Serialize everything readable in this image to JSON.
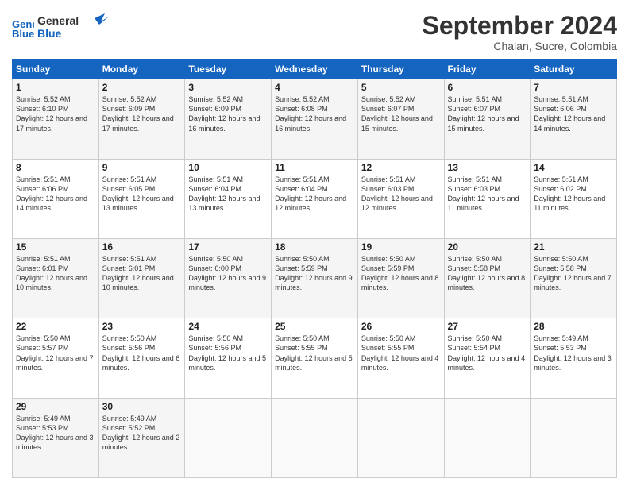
{
  "logo": {
    "line1": "General",
    "line2": "Blue"
  },
  "header": {
    "month_title": "September 2024",
    "subtitle": "Chalan, Sucre, Colombia"
  },
  "weekdays": [
    "Sunday",
    "Monday",
    "Tuesday",
    "Wednesday",
    "Thursday",
    "Friday",
    "Saturday"
  ],
  "weeks": [
    [
      {
        "day": "1",
        "sunrise": "Sunrise: 5:52 AM",
        "sunset": "Sunset: 6:10 PM",
        "daylight": "Daylight: 12 hours and 17 minutes."
      },
      {
        "day": "2",
        "sunrise": "Sunrise: 5:52 AM",
        "sunset": "Sunset: 6:09 PM",
        "daylight": "Daylight: 12 hours and 17 minutes."
      },
      {
        "day": "3",
        "sunrise": "Sunrise: 5:52 AM",
        "sunset": "Sunset: 6:09 PM",
        "daylight": "Daylight: 12 hours and 16 minutes."
      },
      {
        "day": "4",
        "sunrise": "Sunrise: 5:52 AM",
        "sunset": "Sunset: 6:08 PM",
        "daylight": "Daylight: 12 hours and 16 minutes."
      },
      {
        "day": "5",
        "sunrise": "Sunrise: 5:52 AM",
        "sunset": "Sunset: 6:07 PM",
        "daylight": "Daylight: 12 hours and 15 minutes."
      },
      {
        "day": "6",
        "sunrise": "Sunrise: 5:51 AM",
        "sunset": "Sunset: 6:07 PM",
        "daylight": "Daylight: 12 hours and 15 minutes."
      },
      {
        "day": "7",
        "sunrise": "Sunrise: 5:51 AM",
        "sunset": "Sunset: 6:06 PM",
        "daylight": "Daylight: 12 hours and 14 minutes."
      }
    ],
    [
      {
        "day": "8",
        "sunrise": "Sunrise: 5:51 AM",
        "sunset": "Sunset: 6:06 PM",
        "daylight": "Daylight: 12 hours and 14 minutes."
      },
      {
        "day": "9",
        "sunrise": "Sunrise: 5:51 AM",
        "sunset": "Sunset: 6:05 PM",
        "daylight": "Daylight: 12 hours and 13 minutes."
      },
      {
        "day": "10",
        "sunrise": "Sunrise: 5:51 AM",
        "sunset": "Sunset: 6:04 PM",
        "daylight": "Daylight: 12 hours and 13 minutes."
      },
      {
        "day": "11",
        "sunrise": "Sunrise: 5:51 AM",
        "sunset": "Sunset: 6:04 PM",
        "daylight": "Daylight: 12 hours and 12 minutes."
      },
      {
        "day": "12",
        "sunrise": "Sunrise: 5:51 AM",
        "sunset": "Sunset: 6:03 PM",
        "daylight": "Daylight: 12 hours and 12 minutes."
      },
      {
        "day": "13",
        "sunrise": "Sunrise: 5:51 AM",
        "sunset": "Sunset: 6:03 PM",
        "daylight": "Daylight: 12 hours and 11 minutes."
      },
      {
        "day": "14",
        "sunrise": "Sunrise: 5:51 AM",
        "sunset": "Sunset: 6:02 PM",
        "daylight": "Daylight: 12 hours and 11 minutes."
      }
    ],
    [
      {
        "day": "15",
        "sunrise": "Sunrise: 5:51 AM",
        "sunset": "Sunset: 6:01 PM",
        "daylight": "Daylight: 12 hours and 10 minutes."
      },
      {
        "day": "16",
        "sunrise": "Sunrise: 5:51 AM",
        "sunset": "Sunset: 6:01 PM",
        "daylight": "Daylight: 12 hours and 10 minutes."
      },
      {
        "day": "17",
        "sunrise": "Sunrise: 5:50 AM",
        "sunset": "Sunset: 6:00 PM",
        "daylight": "Daylight: 12 hours and 9 minutes."
      },
      {
        "day": "18",
        "sunrise": "Sunrise: 5:50 AM",
        "sunset": "Sunset: 5:59 PM",
        "daylight": "Daylight: 12 hours and 9 minutes."
      },
      {
        "day": "19",
        "sunrise": "Sunrise: 5:50 AM",
        "sunset": "Sunset: 5:59 PM",
        "daylight": "Daylight: 12 hours and 8 minutes."
      },
      {
        "day": "20",
        "sunrise": "Sunrise: 5:50 AM",
        "sunset": "Sunset: 5:58 PM",
        "daylight": "Daylight: 12 hours and 8 minutes."
      },
      {
        "day": "21",
        "sunrise": "Sunrise: 5:50 AM",
        "sunset": "Sunset: 5:58 PM",
        "daylight": "Daylight: 12 hours and 7 minutes."
      }
    ],
    [
      {
        "day": "22",
        "sunrise": "Sunrise: 5:50 AM",
        "sunset": "Sunset: 5:57 PM",
        "daylight": "Daylight: 12 hours and 7 minutes."
      },
      {
        "day": "23",
        "sunrise": "Sunrise: 5:50 AM",
        "sunset": "Sunset: 5:56 PM",
        "daylight": "Daylight: 12 hours and 6 minutes."
      },
      {
        "day": "24",
        "sunrise": "Sunrise: 5:50 AM",
        "sunset": "Sunset: 5:56 PM",
        "daylight": "Daylight: 12 hours and 5 minutes."
      },
      {
        "day": "25",
        "sunrise": "Sunrise: 5:50 AM",
        "sunset": "Sunset: 5:55 PM",
        "daylight": "Daylight: 12 hours and 5 minutes."
      },
      {
        "day": "26",
        "sunrise": "Sunrise: 5:50 AM",
        "sunset": "Sunset: 5:55 PM",
        "daylight": "Daylight: 12 hours and 4 minutes."
      },
      {
        "day": "27",
        "sunrise": "Sunrise: 5:50 AM",
        "sunset": "Sunset: 5:54 PM",
        "daylight": "Daylight: 12 hours and 4 minutes."
      },
      {
        "day": "28",
        "sunrise": "Sunrise: 5:49 AM",
        "sunset": "Sunset: 5:53 PM",
        "daylight": "Daylight: 12 hours and 3 minutes."
      }
    ],
    [
      {
        "day": "29",
        "sunrise": "Sunrise: 5:49 AM",
        "sunset": "Sunset: 5:53 PM",
        "daylight": "Daylight: 12 hours and 3 minutes."
      },
      {
        "day": "30",
        "sunrise": "Sunrise: 5:49 AM",
        "sunset": "Sunset: 5:52 PM",
        "daylight": "Daylight: 12 hours and 2 minutes."
      },
      null,
      null,
      null,
      null,
      null
    ]
  ]
}
